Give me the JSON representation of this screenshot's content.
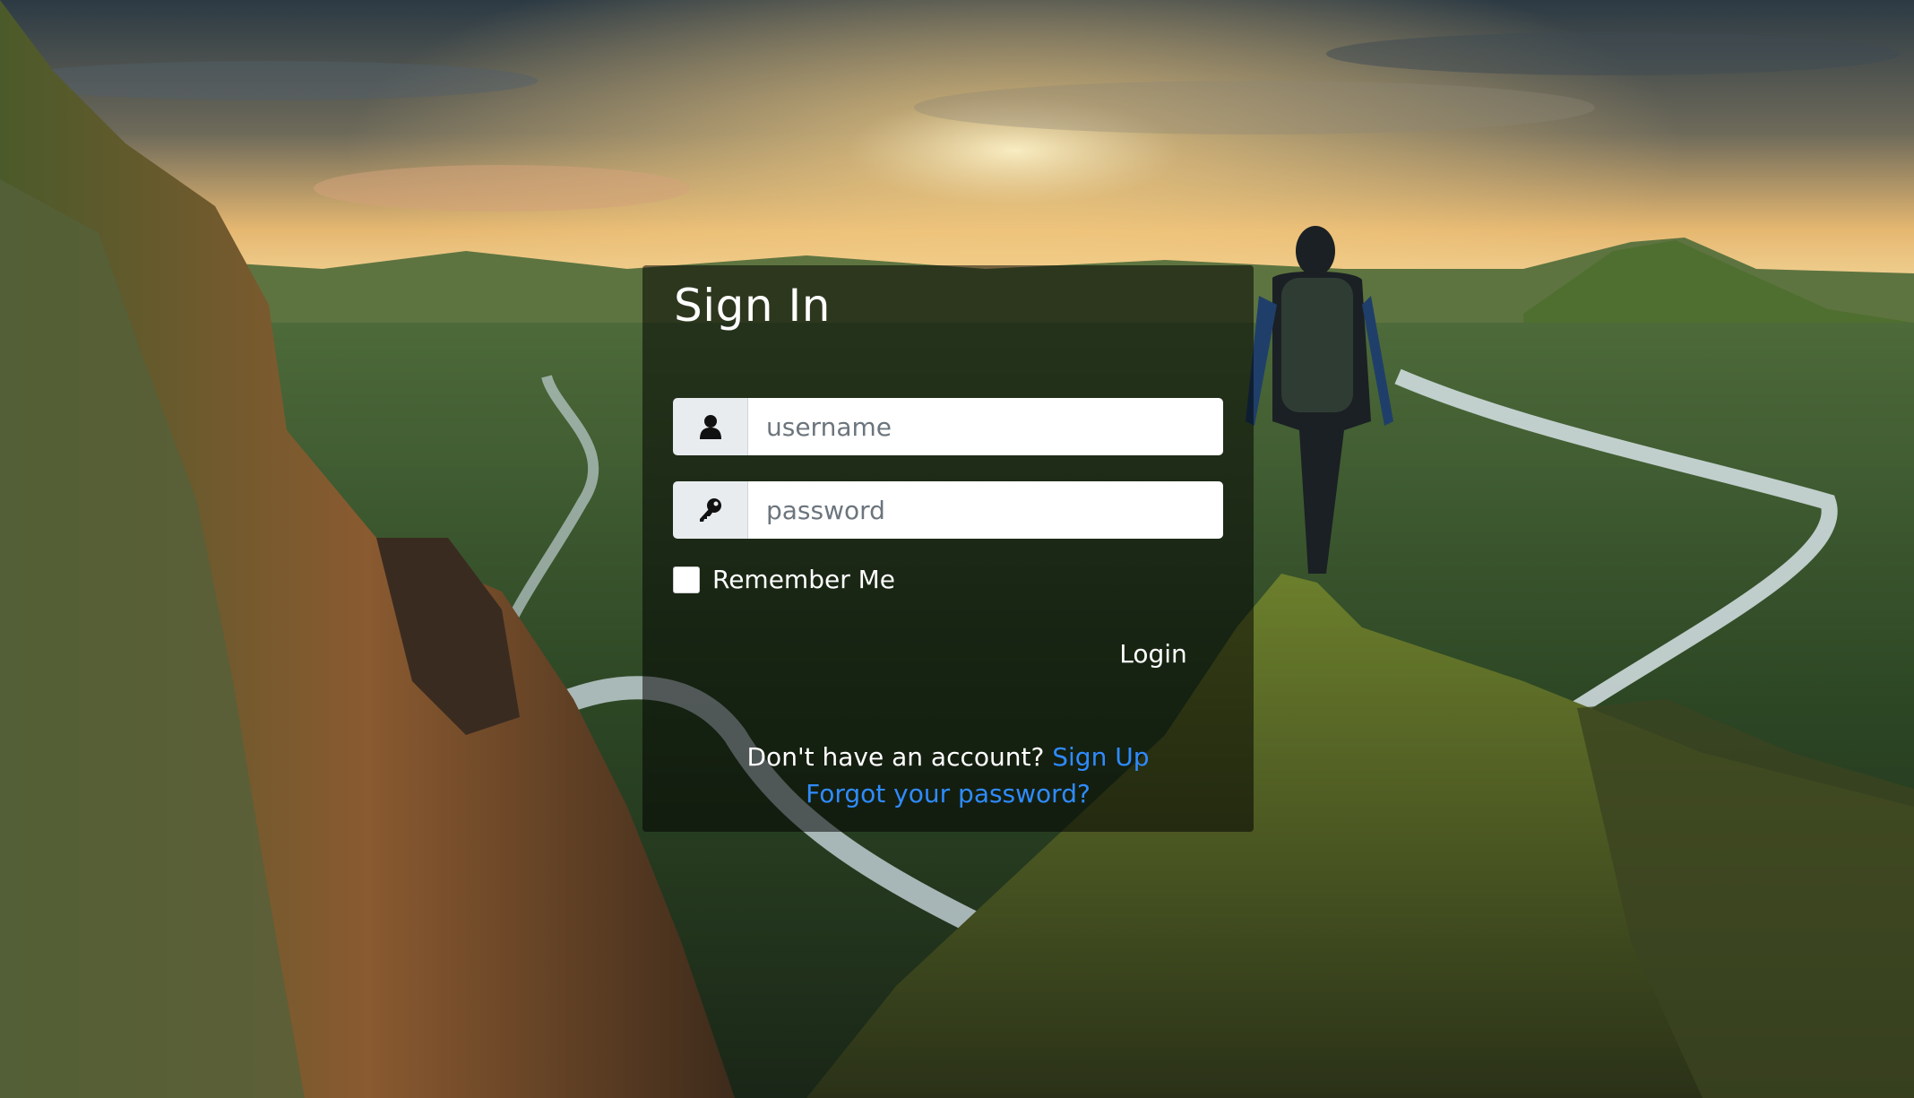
{
  "signin": {
    "title": "Sign In",
    "username_placeholder": "username",
    "password_placeholder": "password",
    "remember_label": "Remember Me",
    "remember_checked": false,
    "login_label": "Login",
    "no_account_text": "Don't have an account?",
    "signup_label": "Sign Up",
    "forgot_label": "Forgot your password?"
  },
  "icons": {
    "username": "user-icon",
    "password": "key-icon"
  },
  "colors": {
    "link": "#2f8bff",
    "card_overlay": "rgba(0,0,0,0.52)",
    "addon_bg": "#e9ecef"
  }
}
